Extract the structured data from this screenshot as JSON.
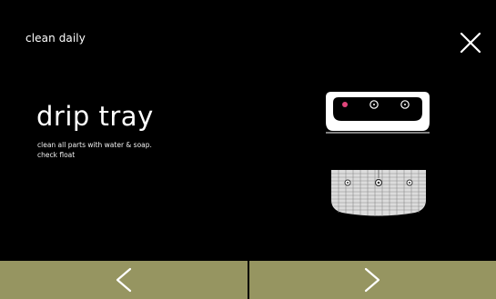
{
  "header": {
    "title": "clean daily",
    "close_icon": "close-icon"
  },
  "step": {
    "title": "drip tray",
    "instructions": [
      "clean all parts with water & soap.",
      "check float"
    ]
  },
  "illustration": {
    "parts": [
      "drip-tray-front-icon",
      "drip-tray-grid-icon"
    ],
    "indicator_color": "#e0457b"
  },
  "navigation": {
    "prev_icon": "chevron-left-icon",
    "next_icon": "chevron-right-icon",
    "button_color": "#969561"
  }
}
